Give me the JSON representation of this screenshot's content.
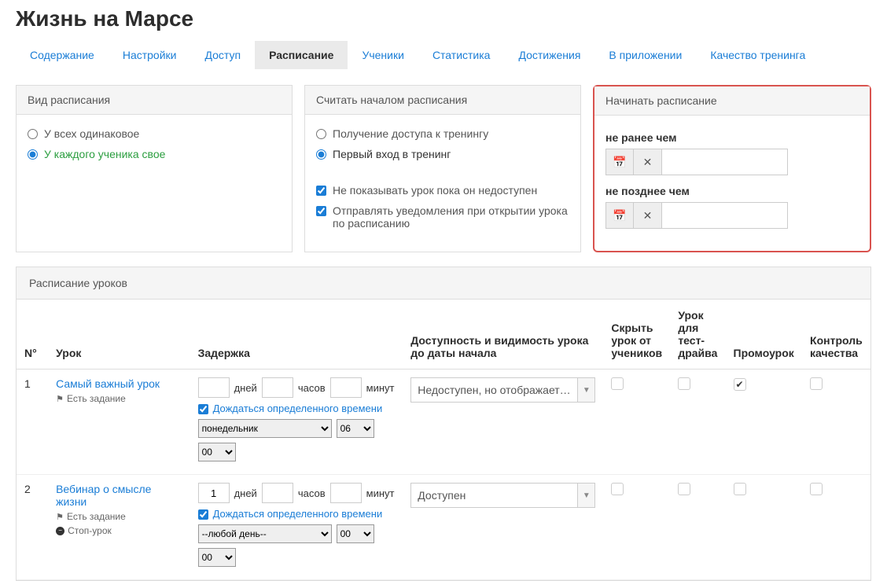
{
  "title": "Жизнь на Марсе",
  "tabs": [
    "Содержание",
    "Настройки",
    "Доступ",
    "Расписание",
    "Ученики",
    "Статистика",
    "Достижения",
    "В приложении",
    "Качество тренинга"
  ],
  "active_tab": 3,
  "panel1": {
    "title": "Вид расписания",
    "opt1": "У всех одинаковое",
    "opt2": "У каждого ученика свое"
  },
  "panel2": {
    "title": "Считать началом расписания",
    "opt1": "Получение доступа к тренингу",
    "opt2": "Первый вход в тренинг",
    "chk1": "Не показывать урок пока он недоступен",
    "chk2": "Отправлять уведомления при открытии урока по расписанию"
  },
  "panel3": {
    "title": "Начинать расписание",
    "label1": "не ранее чем",
    "label2": "не позднее чем"
  },
  "schedule": {
    "title": "Расписание уроков",
    "cols": {
      "num": "N°",
      "lesson": "Урок",
      "delay": "Задержка",
      "avail": "Доступность и видимость урока до даты начала",
      "hide": "Скрыть урок от учеников",
      "testdrive": "Урок для тест-драйва",
      "promo": "Промоурок",
      "qc": "Контроль качества"
    },
    "delay_labels": {
      "days": "дней",
      "hours": "часов",
      "mins": "минут"
    },
    "wait_label": "Дождаться определенного времени",
    "rows": [
      {
        "num": "1",
        "title": "Самый важный урок",
        "has_task": "Есть задание",
        "stop": false,
        "days": "",
        "hours": "",
        "mins": "",
        "wait": true,
        "day": "понедельник",
        "hh": "06",
        "mm": "00",
        "avail": "Недоступен, но отображает…",
        "hide": false,
        "testdrive": false,
        "promo": true,
        "qc": false
      },
      {
        "num": "2",
        "title": "Вебинар о смысле жизни",
        "has_task": "Есть задание",
        "stop": true,
        "stop_label": "Стоп-урок",
        "days": "1",
        "hours": "",
        "mins": "",
        "wait": true,
        "day": "--любой день--",
        "hh": "00",
        "mm": "00",
        "avail": "Доступен",
        "hide": false,
        "testdrive": false,
        "promo": false,
        "qc": false
      }
    ]
  }
}
